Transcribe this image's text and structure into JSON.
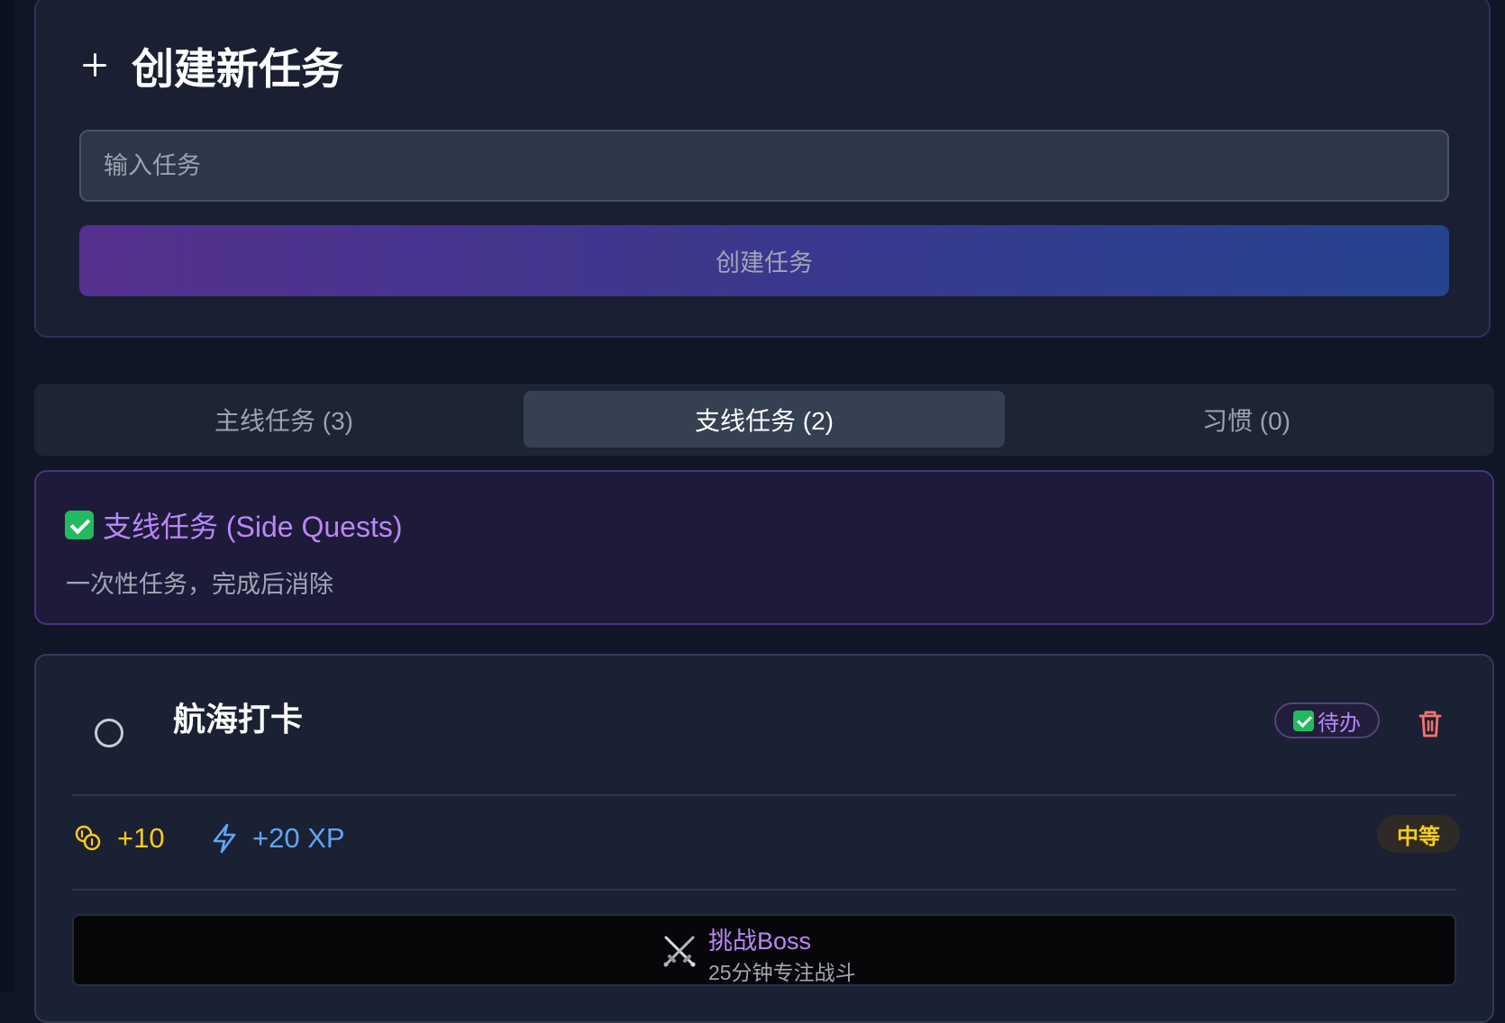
{
  "create_panel": {
    "title": "创建新任务",
    "input_placeholder": "输入任务",
    "button_label": "创建任务"
  },
  "tabs": [
    {
      "label": "主线任务 (3)",
      "active": false
    },
    {
      "label": "支线任务 (2)",
      "active": true
    },
    {
      "label": "习惯 (0)",
      "active": false
    }
  ],
  "section_info": {
    "title": "支线任务 (Side Quests)",
    "subtitle": "一次性任务，完成后消除",
    "icon": "check-mark-icon"
  },
  "task": {
    "name": "航海打卡",
    "status": "待办",
    "coins": "+10",
    "xp": "+20 XP",
    "difficulty": "中等",
    "boss_button": {
      "title": "挑战Boss",
      "subtitle": "25分钟专注战斗"
    }
  },
  "colors": {
    "background": "#111627",
    "card": "#1a2132",
    "purple_accent": "#b987f7",
    "coin_yellow": "#facc15",
    "xp_blue": "#60a5fa",
    "delete_red": "#f87171"
  }
}
